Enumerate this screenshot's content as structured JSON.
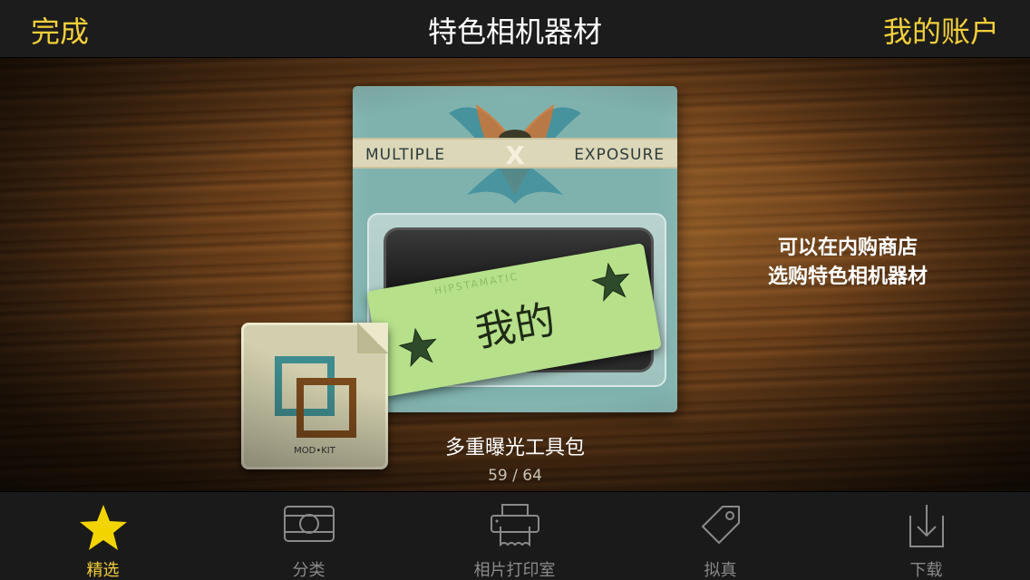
{
  "nav": {
    "left_button": "完成",
    "title": "特色相机器材",
    "right_button": "我的账户"
  },
  "featured": {
    "package_band_left": "MULTIPLE",
    "package_band_right": "EXPOSURE",
    "package_emblem": "X",
    "ticket_label": "我的",
    "ticket_edge_text": "HIPSTAMATIC",
    "modkit_label": "MOD•KIT",
    "item_name": "多重曝光工具包",
    "page_indicator": "59 /  64"
  },
  "side_message": {
    "line1": "可以在内购商店",
    "line2": "选购特色相机器材"
  },
  "tabs": [
    {
      "label": "精选",
      "icon": "star-icon",
      "active": true
    },
    {
      "label": "分类",
      "icon": "camera-icon",
      "active": false
    },
    {
      "label": "相片打印室",
      "icon": "printer-icon",
      "active": false
    },
    {
      "label": "拟真",
      "icon": "tag-icon",
      "active": false
    },
    {
      "label": "下载",
      "icon": "download-icon",
      "active": false
    }
  ],
  "colors": {
    "accent": "#f2cf3a",
    "tab_inactive": "#8a8a8a",
    "package": "#7fb2ad",
    "ticket": "#b6e08a"
  }
}
